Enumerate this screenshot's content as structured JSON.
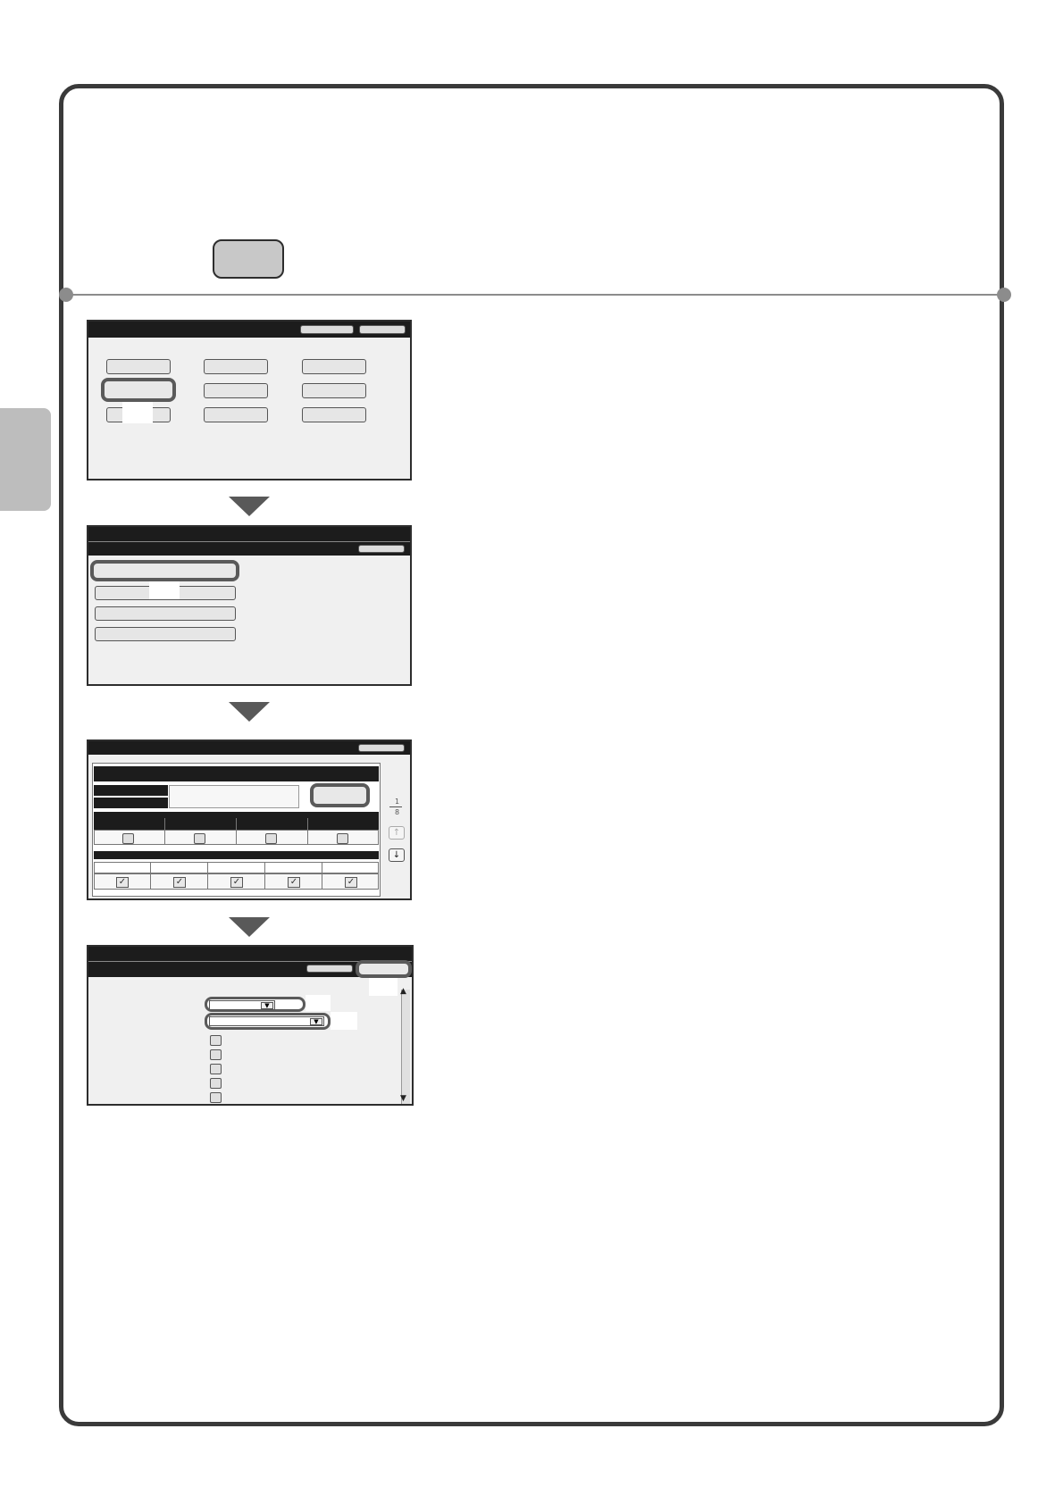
{
  "screen3": {
    "page_current": "1",
    "page_total": "8",
    "up_arrow": "↑",
    "down_arrow": "↓"
  },
  "screen4": {
    "scroll_up": "▲",
    "scroll_down": "▼",
    "dropdown_arrow": "▼"
  },
  "check_mark": "✓",
  "colors": {
    "frame": "#3a3a3a",
    "side_tab": "#bdbdbd",
    "arrow": "#595959",
    "screen_bar": "#1c1c1c"
  }
}
